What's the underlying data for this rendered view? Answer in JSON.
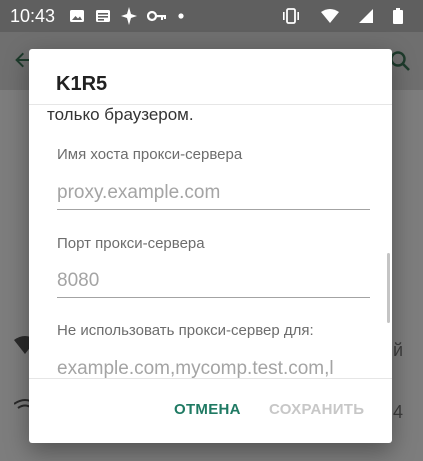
{
  "status_bar": {
    "time": "10:43",
    "left_icons": [
      "image-icon",
      "news-icon",
      "sparkle-icon",
      "key-icon",
      "dot-icon"
    ],
    "right_icons": [
      "vibrate-icon",
      "wifi-icon",
      "signal-icon",
      "battery-icon"
    ]
  },
  "dialog": {
    "title": "K1R5",
    "message_tail": "только браузером.",
    "host": {
      "label": "Имя хоста прокси-сервера",
      "placeholder": "proxy.example.com"
    },
    "port": {
      "label": "Порт прокси-сервера",
      "placeholder": "8080"
    },
    "exclusion": {
      "label": "Не использовать прокси-сервер для:",
      "placeholder": "example.com,mycomp.test.com,l"
    },
    "buttons": {
      "cancel": "ОТМЕНА",
      "save": "СОХРАНИТЬ"
    }
  },
  "colors": {
    "accent": "#1f7a63",
    "disabled": "#c7c7c7"
  }
}
